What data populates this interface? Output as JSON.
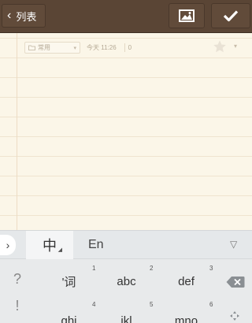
{
  "topbar": {
    "back_label": "列表"
  },
  "note": {
    "folder": "常用",
    "time": "今天 11:26",
    "count": "0"
  },
  "keyboard": {
    "mode_zh": "中",
    "mode_en": "En",
    "side_keys": [
      "?",
      "!"
    ],
    "keys": [
      {
        "label": "'词",
        "num": "1"
      },
      {
        "label": "abc",
        "num": "2"
      },
      {
        "label": "def",
        "num": "3"
      },
      {
        "label": "ghi",
        "num": "4"
      },
      {
        "label": "jkl",
        "num": "5"
      },
      {
        "label": "mno",
        "num": "6"
      }
    ]
  }
}
